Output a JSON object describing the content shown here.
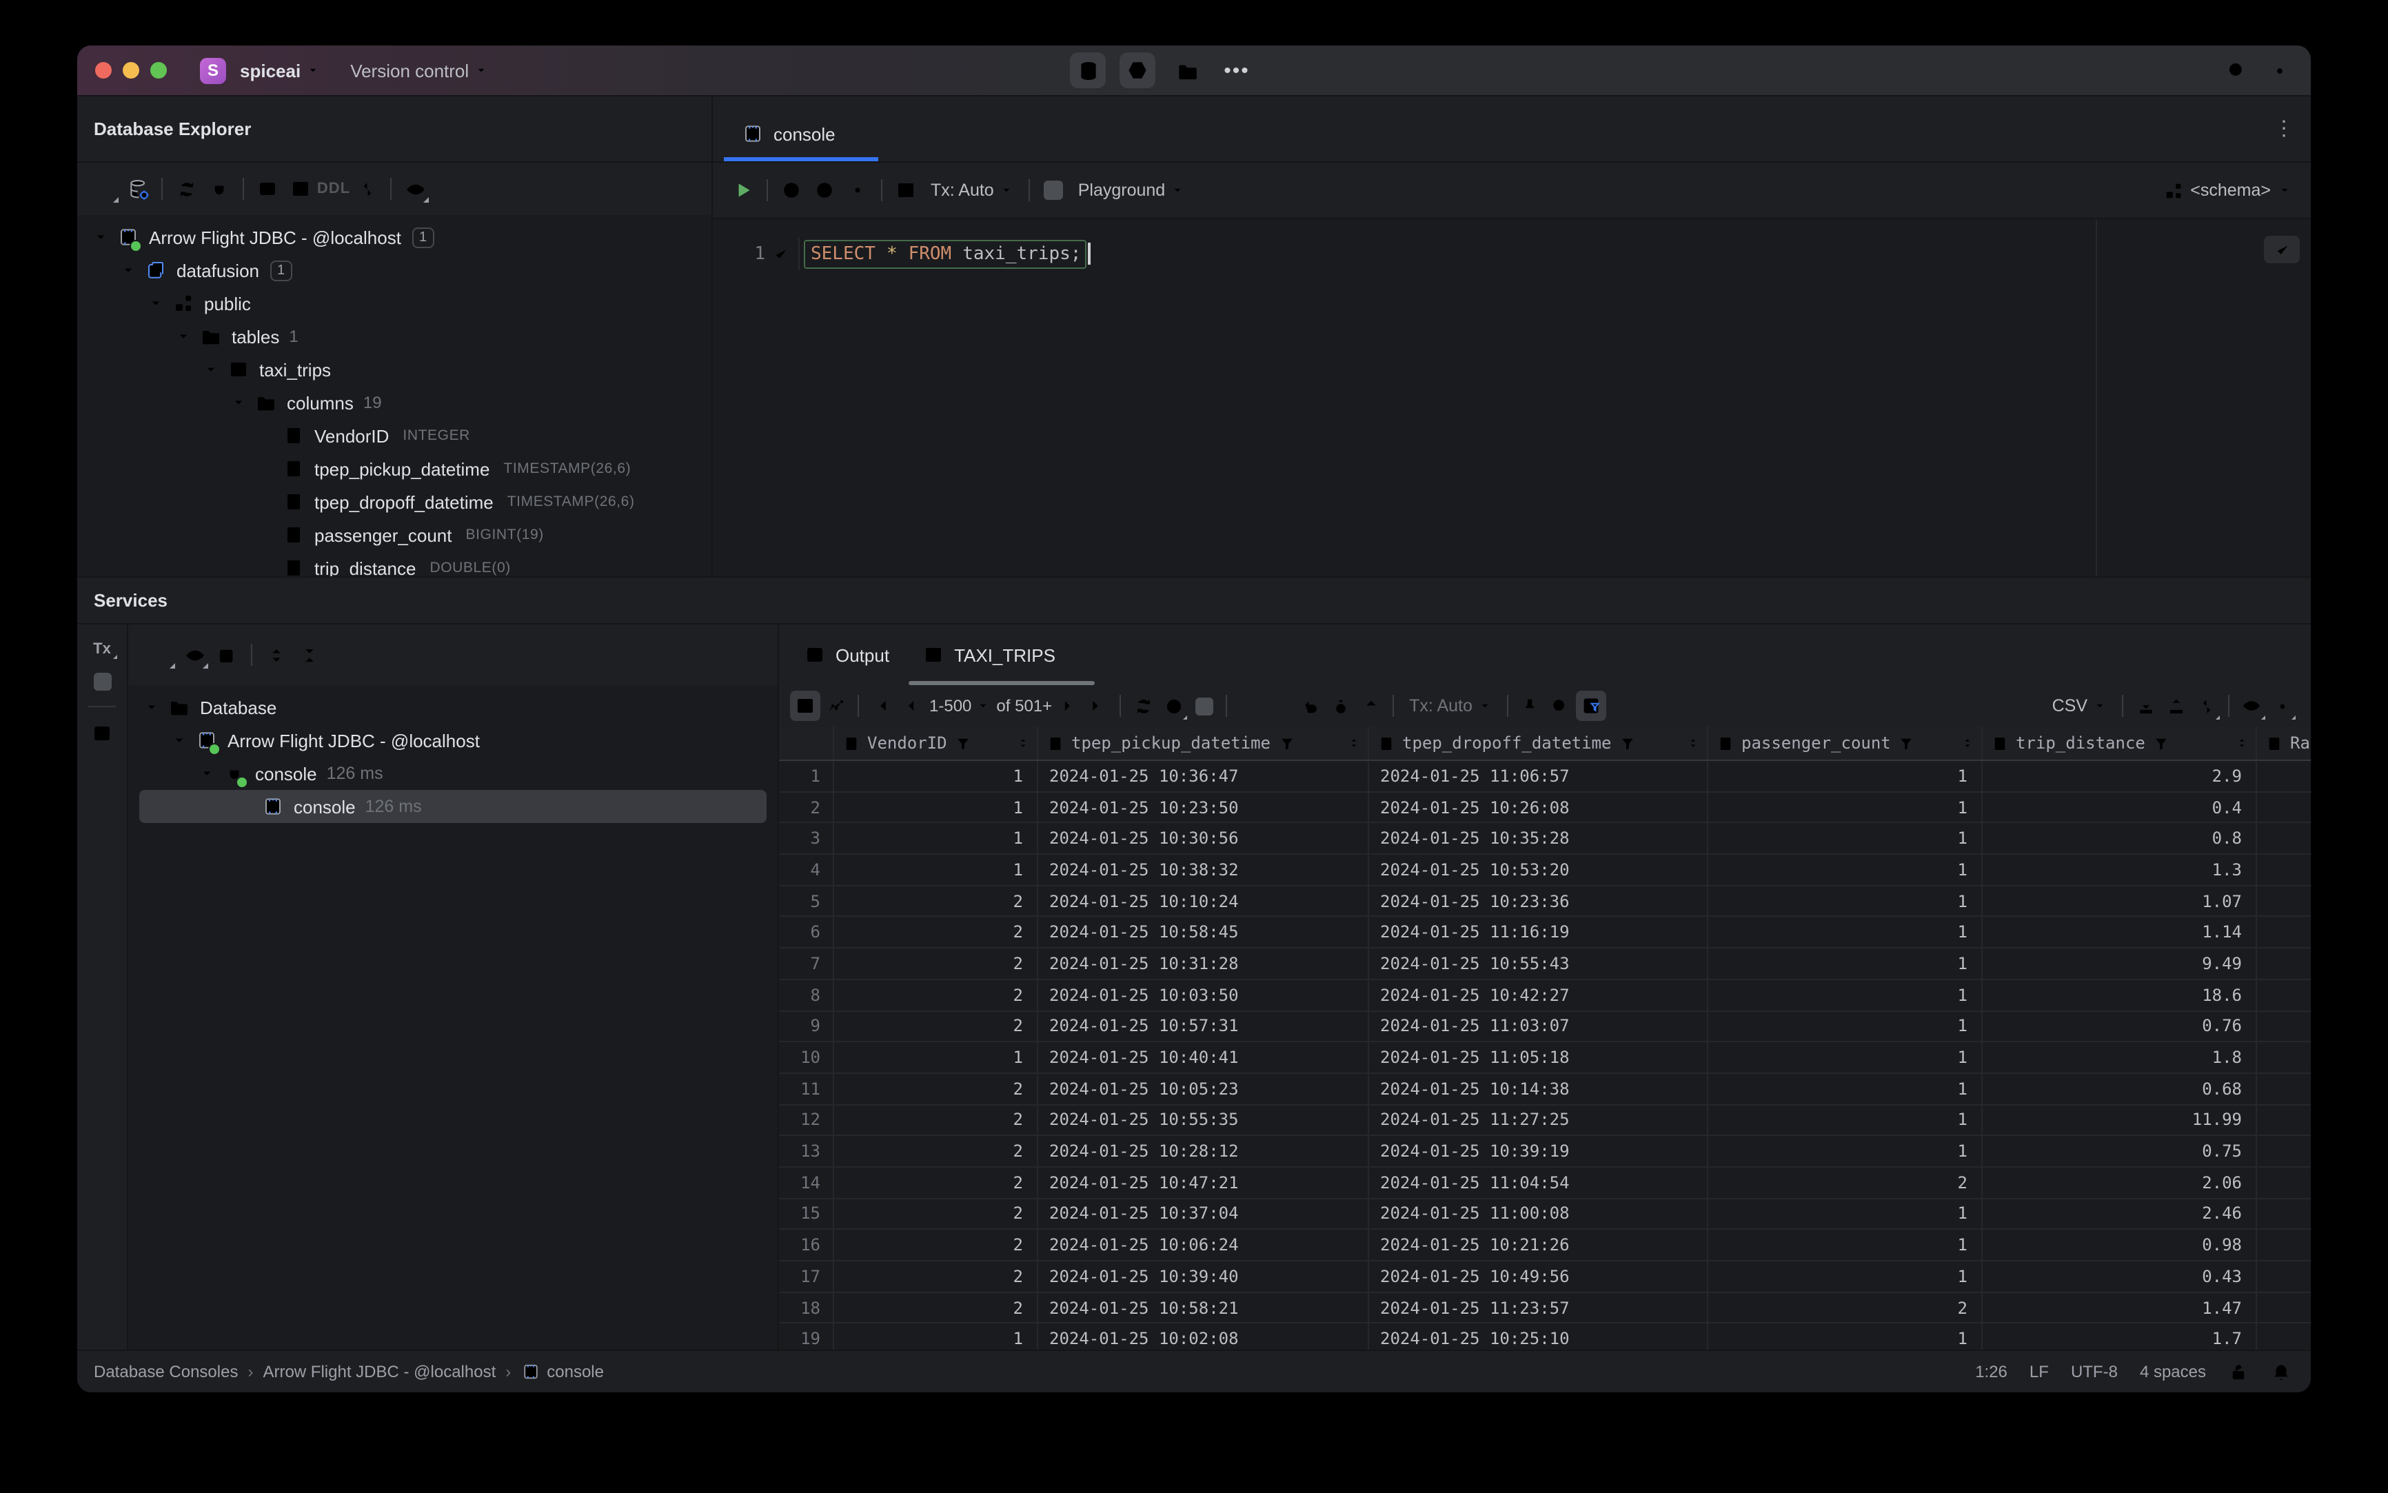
{
  "titlebar": {
    "app_initial": "S",
    "project": "spiceai",
    "menu": "Version control"
  },
  "explorer": {
    "title": "Database Explorer",
    "ddl_label": "DDL",
    "tree": [
      {
        "level": 0,
        "icon": "dbfile",
        "dot": true,
        "label": "Arrow Flight JDBC - @localhost",
        "badge": "1",
        "expanded": true
      },
      {
        "level": 1,
        "icon": "db2",
        "label": "datafusion",
        "badge": "1",
        "expanded": true
      },
      {
        "level": 2,
        "icon": "schema",
        "label": "public",
        "expanded": true
      },
      {
        "level": 3,
        "icon": "folder",
        "color": "c-blue",
        "label": "tables",
        "count": "1",
        "expanded": true
      },
      {
        "level": 4,
        "icon": "table",
        "label": "taxi_trips",
        "expanded": true
      },
      {
        "level": 5,
        "icon": "folder",
        "color": "c-blue",
        "label": "columns",
        "count": "19",
        "expanded": true
      },
      {
        "level": 6,
        "icon": "column",
        "label": "VendorID",
        "type": "INTEGER"
      },
      {
        "level": 6,
        "icon": "column",
        "label": "tpep_pickup_datetime",
        "type": "TIMESTAMP(26,6)"
      },
      {
        "level": 6,
        "icon": "column",
        "label": "tpep_dropoff_datetime",
        "type": "TIMESTAMP(26,6)"
      },
      {
        "level": 6,
        "icon": "column",
        "label": "passenger_count",
        "type": "BIGINT(19)"
      },
      {
        "level": 6,
        "icon": "column",
        "label": "trip_distance",
        "type": "DOUBLE(0)"
      }
    ]
  },
  "editor": {
    "tab_label": "console",
    "tx": "Tx: Auto",
    "playground": "Playground",
    "schema": "<schema>",
    "line_number": "1",
    "sql": {
      "kw1": "SELECT",
      "star": "*",
      "kw2": "FROM",
      "ident": "taxi_trips",
      "semi": ";"
    }
  },
  "services": {
    "title": "Services",
    "rail_tx": "Tx",
    "tree": [
      {
        "level": 0,
        "icon": "folder",
        "color": "c-gray",
        "label": "Database",
        "expanded": true
      },
      {
        "level": 1,
        "icon": "dbfile",
        "dot": true,
        "label": "Arrow Flight JDBC - @localhost",
        "expanded": true
      },
      {
        "level": 2,
        "icon": "plug",
        "dot": true,
        "label": "console",
        "time": "126 ms",
        "expanded": true
      },
      {
        "level": 3,
        "icon": "dbfile",
        "label": "console",
        "time": "126 ms",
        "selected": true
      }
    ]
  },
  "results": {
    "output_tab": "Output",
    "data_tab": "TAXI_TRIPS",
    "pager_range": "1-500",
    "pager_of": "of 501+",
    "tx": "Tx: Auto",
    "export_format": "CSV",
    "grid": {
      "columns": [
        {
          "name": "VendorID",
          "align": "right"
        },
        {
          "name": "tpep_pickup_datetime",
          "align": "left"
        },
        {
          "name": "tpep_dropoff_datetime",
          "align": "left"
        },
        {
          "name": "passenger_count",
          "align": "right"
        },
        {
          "name": "trip_distance",
          "align": "right"
        },
        {
          "name": "Rate",
          "align": "right"
        }
      ],
      "rows": [
        [
          "1",
          "1",
          "2024-01-25 10:36:47",
          "2024-01-25 11:06:57",
          "1",
          "2.9"
        ],
        [
          "2",
          "1",
          "2024-01-25 10:23:50",
          "2024-01-25 10:26:08",
          "1",
          "0.4"
        ],
        [
          "3",
          "1",
          "2024-01-25 10:30:56",
          "2024-01-25 10:35:28",
          "1",
          "0.8"
        ],
        [
          "4",
          "1",
          "2024-01-25 10:38:32",
          "2024-01-25 10:53:20",
          "1",
          "1.3"
        ],
        [
          "5",
          "2",
          "2024-01-25 10:10:24",
          "2024-01-25 10:23:36",
          "1",
          "1.07"
        ],
        [
          "6",
          "2",
          "2024-01-25 10:58:45",
          "2024-01-25 11:16:19",
          "1",
          "1.14"
        ],
        [
          "7",
          "2",
          "2024-01-25 10:31:28",
          "2024-01-25 10:55:43",
          "1",
          "9.49"
        ],
        [
          "8",
          "2",
          "2024-01-25 10:03:50",
          "2024-01-25 10:42:27",
          "1",
          "18.6"
        ],
        [
          "9",
          "2",
          "2024-01-25 10:57:31",
          "2024-01-25 11:03:07",
          "1",
          "0.76"
        ],
        [
          "10",
          "1",
          "2024-01-25 10:40:41",
          "2024-01-25 11:05:18",
          "1",
          "1.8"
        ],
        [
          "11",
          "2",
          "2024-01-25 10:05:23",
          "2024-01-25 10:14:38",
          "1",
          "0.68"
        ],
        [
          "12",
          "2",
          "2024-01-25 10:55:35",
          "2024-01-25 11:27:25",
          "1",
          "11.99"
        ],
        [
          "13",
          "2",
          "2024-01-25 10:28:12",
          "2024-01-25 10:39:19",
          "1",
          "0.75"
        ],
        [
          "14",
          "2",
          "2024-01-25 10:47:21",
          "2024-01-25 11:04:54",
          "2",
          "2.06"
        ],
        [
          "15",
          "2",
          "2024-01-25 10:37:04",
          "2024-01-25 11:00:08",
          "1",
          "2.46"
        ],
        [
          "16",
          "2",
          "2024-01-25 10:06:24",
          "2024-01-25 10:21:26",
          "1",
          "0.98"
        ],
        [
          "17",
          "2",
          "2024-01-25 10:39:40",
          "2024-01-25 10:49:56",
          "1",
          "0.43"
        ],
        [
          "18",
          "2",
          "2024-01-25 10:58:21",
          "2024-01-25 11:23:57",
          "2",
          "1.47"
        ],
        [
          "19",
          "1",
          "2024-01-25 10:02:08",
          "2024-01-25 10:25:10",
          "1",
          "1.7"
        ]
      ]
    }
  },
  "statusbar": {
    "breadcrumbs": [
      "Database Consoles",
      "Arrow Flight JDBC - @localhost",
      "console"
    ],
    "caret": "1:26",
    "line_ending": "LF",
    "encoding": "UTF-8",
    "indent": "4 spaces"
  }
}
